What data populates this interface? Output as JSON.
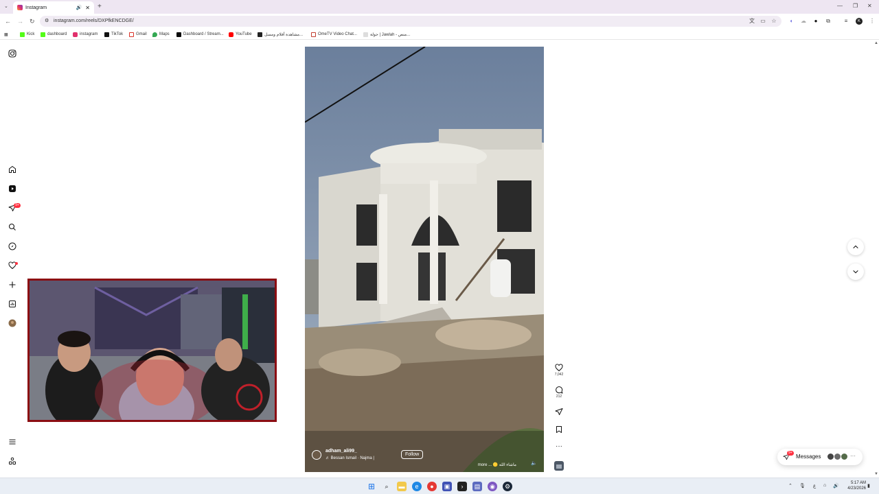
{
  "browser": {
    "tab_title": "Instagram",
    "url": "instagram.com/reels/DXPfkENCDGE/",
    "bookmarks": [
      {
        "label": "Kick",
        "color": "#53fc18"
      },
      {
        "label": "dashboard",
        "color": "#53fc18"
      },
      {
        "label": "instagram",
        "color": "#e1306c"
      },
      {
        "label": "TikTok",
        "color": "#111111"
      },
      {
        "label": "Gmail",
        "color": "#d93025"
      },
      {
        "label": "Maps",
        "color": "#34a853"
      },
      {
        "label": "Dashboard / Stream...",
        "color": "#0a0a0a"
      },
      {
        "label": "YouTube",
        "color": "#ff0000"
      },
      {
        "label": "مشاهدة أفلام ومسل...",
        "color": "#222222"
      },
      {
        "label": "OmeTV Video Chat...",
        "color": "#c0392b"
      },
      {
        "label": "جولة | Jawlah - منص...",
        "color": "#999999"
      }
    ],
    "profile_initial": "K"
  },
  "sidebar": {
    "notifications_badge": "9+"
  },
  "reel": {
    "username": "adham_ali99_",
    "audio": "Bessan Ismail · Najma |",
    "follow_label": "Follow",
    "caption": "ماشاء الله",
    "more": "more ...",
    "likes": "7,042",
    "comments": "212"
  },
  "messages": {
    "label": "Messages",
    "badge": "9+"
  },
  "taskbar": {
    "time": "5:17 AM",
    "date": "4/23/2026"
  },
  "colors": {
    "accent": "#ff3040",
    "chrome_bg": "#eee6f2"
  }
}
